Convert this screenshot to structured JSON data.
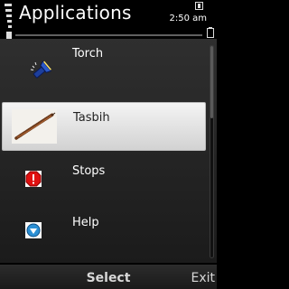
{
  "header": {
    "title": "Applications",
    "clock": "2:50 am"
  },
  "apps": [
    {
      "label": "Torch",
      "icon": "torch-icon"
    },
    {
      "label": "Tasbih",
      "icon": "tasbih-icon",
      "selected": true
    },
    {
      "label": "Stops",
      "icon": "stop-sign-icon",
      "color": "#e01010"
    },
    {
      "label": "Help",
      "icon": "help-icon",
      "color": "#2a8fd4"
    }
  ],
  "softkeys": {
    "center": "Select",
    "right": "Exit"
  },
  "colors": {
    "highlight": "#e6e6e6",
    "background": "#000000"
  }
}
